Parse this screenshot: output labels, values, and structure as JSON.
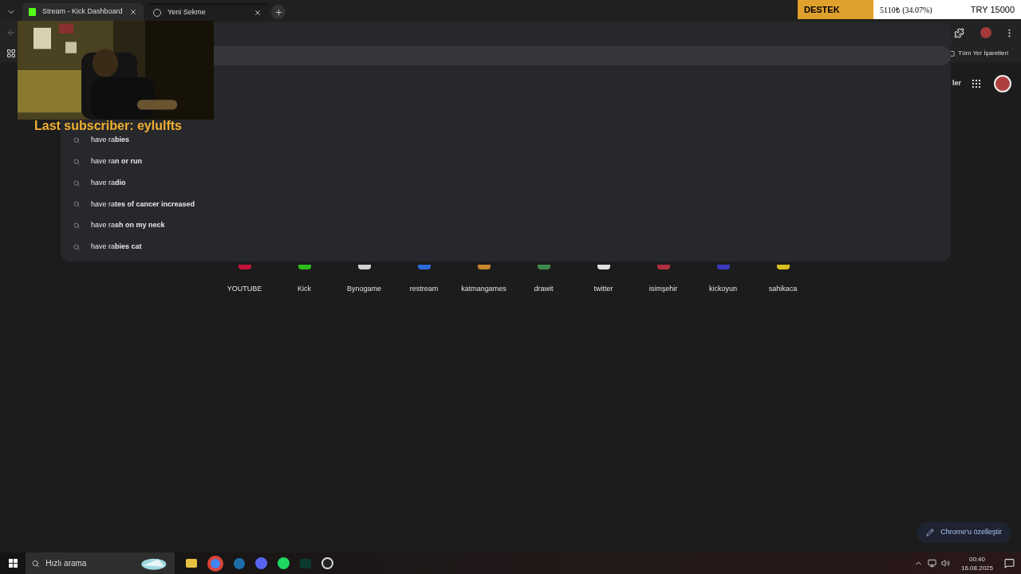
{
  "tabs": [
    {
      "title": "Stream - Kick Dashboard",
      "selected": false
    },
    {
      "title": "Yeni Sekme",
      "selected": true
    }
  ],
  "overlay": {
    "subscriber": "Last subscriber: eylulfts",
    "ticker": {
      "label": "DESTEK",
      "amount": "5110₺ (34.07%)",
      "goal": "TRY 15000"
    }
  },
  "bookmarks": {
    "all": "Tüm Yer İşaretleri"
  },
  "suggestions": [
    "have ra**bies**",
    "have ra**n or run**",
    "have ra**dio**",
    "have ra**tes of cancer increased**",
    "have ra**sh on my neck**",
    "have ra**bies cat**"
  ],
  "ntp": {
    "header_link": "ler"
  },
  "shortcuts": [
    {
      "name": "YOUTUBE",
      "color": "#c4123a"
    },
    {
      "name": "Kick",
      "color": "#2dbd1b"
    },
    {
      "name": "Bynogame",
      "color": "#d0d0d0"
    },
    {
      "name": "restream",
      "color": "#2e6ad8"
    },
    {
      "name": "katmangames",
      "color": "#c8862a"
    },
    {
      "name": "drawit",
      "color": "#3e8a4e"
    },
    {
      "name": "twitter",
      "color": "#e0e0e0"
    },
    {
      "name": "isimşehir",
      "color": "#b03040"
    },
    {
      "name": "kickoyun",
      "color": "#3a3ac0"
    },
    {
      "name": "sahikaca",
      "color": "#d8c020"
    }
  ],
  "customize": "Chrome'u özelleştir",
  "taskbar": {
    "search_placeholder": "Hızlı arama",
    "time": "00:40",
    "date": "16.08.2025"
  }
}
